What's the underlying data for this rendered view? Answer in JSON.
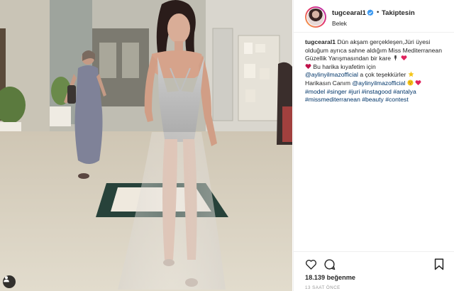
{
  "post": {
    "username": "tugcearal1",
    "follow_separator": "•",
    "follow_status": "Takiptesin",
    "location": "Belek"
  },
  "caption": {
    "username": "tugcearal1",
    "line1": "Dün akşam gerçekleşen,Jüri üyesi olduğum ayrıca sahne aldığım Miss Mediterranean Güzellik Yarışmasından bir kare",
    "line2": "Bu harika kıyafetim için",
    "mention1": "@aylinyilmazofficial",
    "line3": "a çok teşekkürler",
    "line4": "Harikasın Canım",
    "mention2": "@aylinyilmazofficial",
    "hashtags": [
      "#model",
      "#singer",
      "#juri",
      "#instagood",
      "#antalya",
      "#missmediterranean",
      "#beauty",
      "#contest"
    ]
  },
  "stats": {
    "likes": "18.139 beğenme",
    "time": "13 SAAT ÖNCE"
  },
  "icons": {
    "verified": "verified-badge-icon",
    "tag": "user-tag-icon",
    "like": "heart-icon",
    "comment": "comment-icon",
    "save": "bookmark-icon"
  },
  "colors": {
    "text": "#262626",
    "link": "#003569",
    "verified": "#3897f0",
    "muted": "#999999"
  }
}
